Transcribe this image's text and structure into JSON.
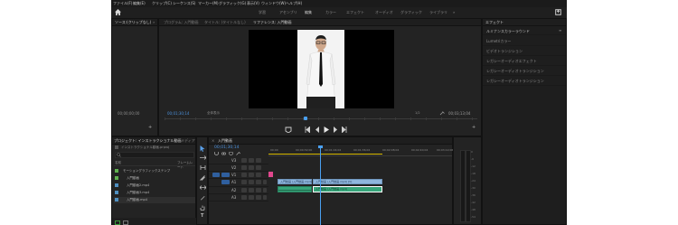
{
  "menu": [
    "ファイル(F)",
    "編集(E)",
    "クリップ(C)",
    "シーケンス(S)",
    "マーカー(M)",
    "グラフィック(G)",
    "表示(V)",
    "ウィンドウ(W)",
    "ヘルプ(H)"
  ],
  "workspaces": [
    "学習",
    "アセンブリ",
    "編集",
    "カラー",
    "エフェクト",
    "オーディオ",
    "グラフィック",
    "ライブラリ"
  ],
  "source_panel": {
    "tab": "ソース:(クリップなし)",
    "timecode": "00;00;00;00"
  },
  "program_panel": {
    "tabs": [
      "プログラム: 入門動画",
      "タイトル: (タイトルなし)",
      "リファレンス: 入門動画"
    ],
    "timecode_left": "00;01;30;14",
    "fit": "全体表示",
    "quality": "1/2",
    "timecode_right": "00;03;13;04"
  },
  "effects_panel": {
    "tab": "エフェクト",
    "items": [
      "ルミナンスカラーラウンド",
      "Lumetriカラー",
      "ビデオトランジション",
      "レガシーオーディオエフェクト",
      "レガシーオーディオトランジション",
      "レガシーオーディオトランジション"
    ]
  },
  "project_panel": {
    "tabs": [
      "プロジェクト: インストラクショナル動画",
      "メディア"
    ],
    "filename": "インストラクショナル動画.prproj",
    "search_placeholder": "",
    "columns": [
      "名前",
      "フレームレート"
    ],
    "items": [
      "モーショングラフィックステンプ",
      "入門動画",
      "入門動画2.mp4",
      "入門動画3.mp4",
      "入門動画.mp4"
    ]
  },
  "timeline": {
    "tab": "入門動画",
    "timecode": "00;01;30;14",
    "ruler": [
      "00;00",
      "00;00;32;00",
      "00;01;04;02",
      "00;01;36;02",
      "00;02;08;04",
      "00;02;40;04",
      "00;03;12;06"
    ],
    "video_tracks": [
      "V3",
      "V2",
      "V1"
    ],
    "audio_tracks": [
      "A1",
      "A2",
      "A3"
    ],
    "clip_labels": [
      "入門動画 (入門動画.mp4) [V]",
      "入門動画 (入門動画.mp4)"
    ]
  },
  "meter": {
    "scale": [
      "0",
      "-6",
      "-12",
      "-18",
      "-24",
      "-30",
      "-36",
      "-42",
      "-48",
      "-54"
    ]
  },
  "colors": {
    "accent": "#2f7bd8",
    "clip_video": "#8fb6dd",
    "clip_audio": "#37a57a",
    "marker": "#e0478d",
    "playhead": "#4aa0f0"
  }
}
